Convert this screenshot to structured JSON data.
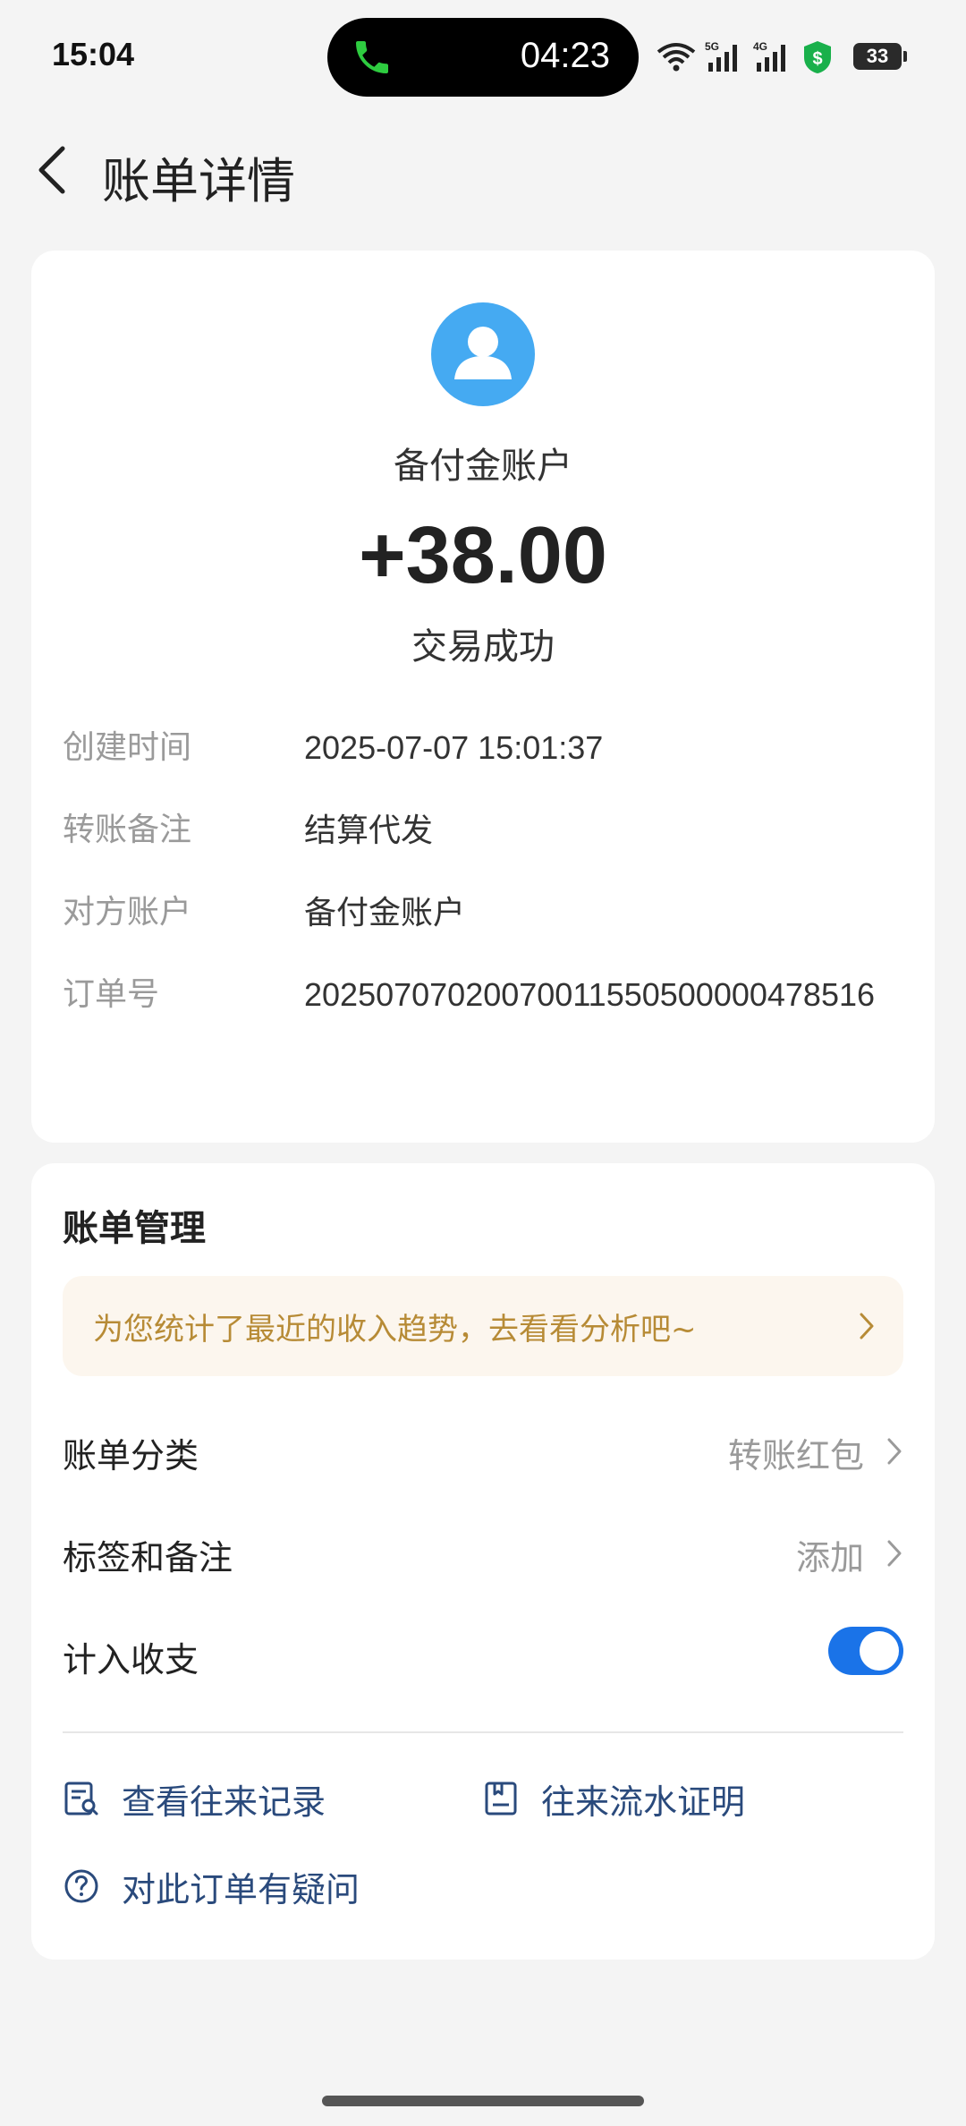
{
  "status_bar": {
    "time": "15:04",
    "call_duration": "04:23",
    "battery": "33",
    "network_1": "5G",
    "network_2": "4G"
  },
  "header": {
    "title": "账单详情"
  },
  "summary": {
    "account_name": "备付金账户",
    "amount": "+38.00",
    "status": "交易成功"
  },
  "details": [
    {
      "label": "创建时间",
      "value": "2025-07-07 15:01:37"
    },
    {
      "label": "转账备注",
      "value": "结算代发"
    },
    {
      "label": "对方账户",
      "value": "备付金账户"
    },
    {
      "label": "订单号",
      "value": "20250707020070011550500000478516"
    }
  ],
  "management": {
    "title": "账单管理",
    "banner": "为您统计了最近的收入趋势，去看看分析吧~",
    "category_label": "账单分类",
    "category_value": "转账红包",
    "tags_label": "标签和备注",
    "tags_value": "添加",
    "count_label": "计入收支",
    "count_enabled": true
  },
  "links": {
    "records": "查看往来记录",
    "proof": "往来流水证明",
    "question": "对此订单有疑问"
  },
  "colors": {
    "accent": "#1a73e8",
    "avatar": "#45aaf2",
    "banner_text": "#b78b36",
    "link": "#2a4a7c"
  }
}
